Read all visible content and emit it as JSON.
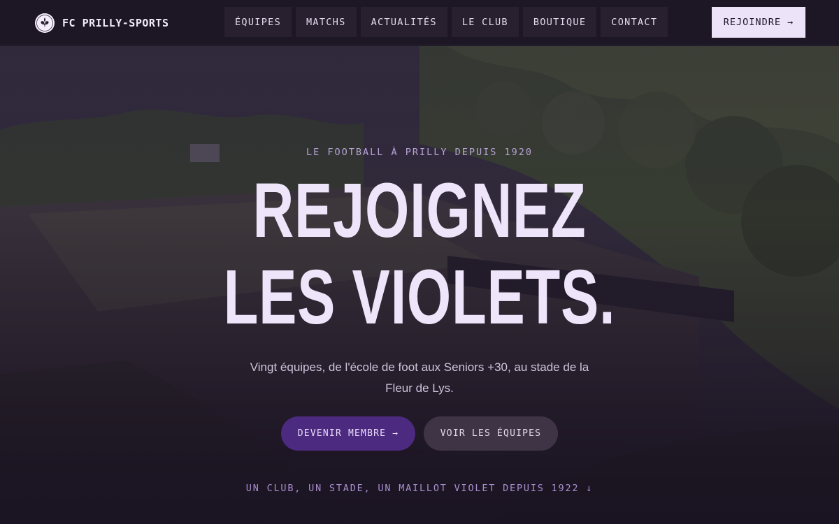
{
  "brand": {
    "name": "FC PRILLY-SPORTS",
    "crest_icon": "fleur-de-lys-crest-icon",
    "crest_text": "PRILLY-SPORTS"
  },
  "nav": {
    "items": [
      {
        "label": "ÉQUIPES"
      },
      {
        "label": "MATCHS"
      },
      {
        "label": "ACTUALITÉS"
      },
      {
        "label": "LE CLUB"
      },
      {
        "label": "BOUTIQUE"
      },
      {
        "label": "CONTACT"
      }
    ],
    "join_label": "REJOINDRE →"
  },
  "hero": {
    "eyebrow": "LE FOOTBALL À PRILLY DEPUIS 1920",
    "headline_line1": "REJOIGNEZ",
    "headline_line2": "LES VIOLETS.",
    "subtitle": "Vingt équipes, de l'école de foot aux Seniors +30, au stade de la Fleur de Lys.",
    "primary_cta": "DEVENIR MEMBRE →",
    "secondary_cta": "VOIR LES ÉQUIPES",
    "tagline": "UN CLUB, UN STADE, UN MAILLOT VIOLET DEPUIS 1922 ↓"
  },
  "colors": {
    "background": "#1a1322",
    "accent_purple": "#4c2a7f",
    "headline": "#eee5fb",
    "eyebrow": "#b8a2d6"
  }
}
